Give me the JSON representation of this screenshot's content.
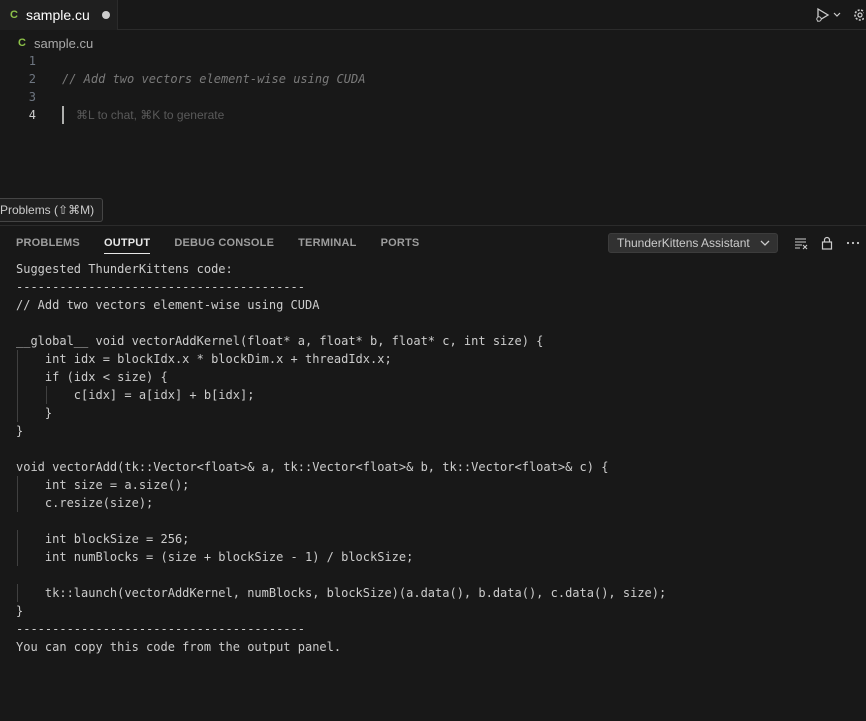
{
  "tab": {
    "label": "sample.cu",
    "icon": "cuda-file-icon"
  },
  "breadcrumb": {
    "label": "sample.cu"
  },
  "editor": {
    "lines": [
      {
        "num": "1",
        "text": ""
      },
      {
        "num": "2",
        "text": "// Add two vectors element-wise using CUDA"
      },
      {
        "num": "3",
        "text": ""
      },
      {
        "num": "4",
        "text": ""
      }
    ],
    "ghost_hint": "⌘L to chat, ⌘K to generate"
  },
  "tooltip": {
    "text": "Problems (⇧⌘M)"
  },
  "panel": {
    "tabs": [
      "PROBLEMS",
      "OUTPUT",
      "DEBUG CONSOLE",
      "TERMINAL",
      "PORTS"
    ],
    "active_tab": "OUTPUT",
    "channel": "ThunderKittens Assistant",
    "output_lines": [
      "Suggested ThunderKittens code:",
      "----------------------------------------",
      "// Add two vectors element-wise using CUDA",
      "",
      "__global__ void vectorAddKernel(float* a, float* b, float* c, int size) {",
      "    int idx = blockIdx.x * blockDim.x + threadIdx.x;",
      "    if (idx < size) {",
      "        c[idx] = a[idx] + b[idx];",
      "    }",
      "}",
      "",
      "void vectorAdd(tk::Vector<float>& a, tk::Vector<float>& b, tk::Vector<float>& c) {",
      "    int size = a.size();",
      "    c.resize(size);",
      "",
      "    int blockSize = 256;",
      "    int numBlocks = (size + blockSize - 1) / blockSize;",
      "",
      "    tk::launch(vectorAddKernel, numBlocks, blockSize)(a.data(), b.data(), c.data(), size);",
      "}",
      "----------------------------------------",
      "You can copy this code from the output panel."
    ]
  }
}
